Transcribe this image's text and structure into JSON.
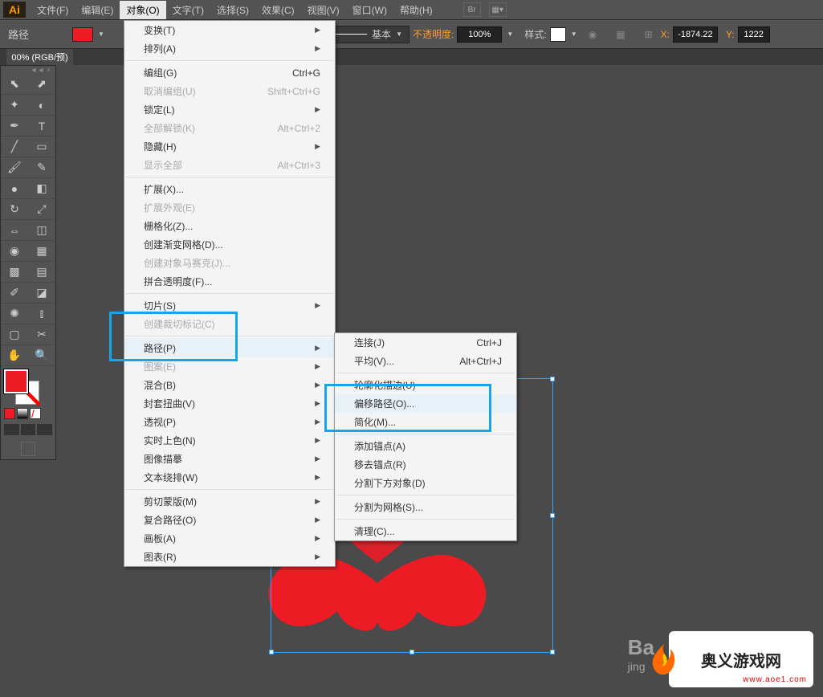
{
  "app": {
    "logo": "Ai"
  },
  "menu": {
    "items": [
      "文件(F)",
      "编辑(E)",
      "对象(O)",
      "文字(T)",
      "选择(S)",
      "效果(C)",
      "视图(V)",
      "窗口(W)",
      "帮助(H)"
    ],
    "active_index": 2,
    "br_label": "Br"
  },
  "controlbar": {
    "selection_label": "路径",
    "fill_color": "#ed1c24",
    "stroke_label": "基本",
    "opacity_label": "不透明度:",
    "opacity_value": "100%",
    "style_label": "样式:",
    "x_label": "X:",
    "x_value": "-1874.22",
    "y_label": "Y:",
    "y_value": "1222"
  },
  "doc": {
    "tab_label": "00% (RGB/预)"
  },
  "dropdown": {
    "groups": [
      [
        {
          "label": "变换(T)",
          "sub": true
        },
        {
          "label": "排列(A)",
          "sub": true
        }
      ],
      [
        {
          "label": "编组(G)",
          "shortcut": "Ctrl+G"
        },
        {
          "label": "取消编组(U)",
          "shortcut": "Shift+Ctrl+G",
          "disabled": true
        },
        {
          "label": "锁定(L)",
          "sub": true
        },
        {
          "label": "全部解锁(K)",
          "shortcut": "Alt+Ctrl+2",
          "disabled": true
        },
        {
          "label": "隐藏(H)",
          "sub": true
        },
        {
          "label": "显示全部",
          "shortcut": "Alt+Ctrl+3",
          "disabled": true
        }
      ],
      [
        {
          "label": "扩展(X)..."
        },
        {
          "label": "扩展外观(E)",
          "disabled": true
        },
        {
          "label": "栅格化(Z)..."
        },
        {
          "label": "创建渐变网格(D)..."
        },
        {
          "label": "创建对象马赛克(J)...",
          "disabled": true
        },
        {
          "label": "拼合透明度(F)..."
        }
      ],
      [
        {
          "label": "切片(S)",
          "sub": true
        },
        {
          "label": "创建裁切标记(C)",
          "disabled": true
        }
      ],
      [
        {
          "label": "路径(P)",
          "sub": true,
          "hover": true
        },
        {
          "label": "图案(E)",
          "sub": true,
          "disabled": true
        },
        {
          "label": "混合(B)",
          "sub": true
        },
        {
          "label": "封套扭曲(V)",
          "sub": true
        },
        {
          "label": "透视(P)",
          "sub": true
        },
        {
          "label": "实时上色(N)",
          "sub": true
        },
        {
          "label": "图像描摹",
          "sub": true
        },
        {
          "label": "文本绕排(W)",
          "sub": true
        }
      ],
      [
        {
          "label": "剪切蒙版(M)",
          "sub": true
        },
        {
          "label": "复合路径(O)",
          "sub": true
        },
        {
          "label": "画板(A)",
          "sub": true
        },
        {
          "label": "图表(R)",
          "sub": true
        }
      ]
    ]
  },
  "submenu": {
    "items": [
      {
        "label": "连接(J)",
        "shortcut": "Ctrl+J"
      },
      {
        "label": "平均(V)...",
        "shortcut": "Alt+Ctrl+J"
      },
      {
        "sep": true
      },
      {
        "label": "轮廓化描边(U)"
      },
      {
        "label": "偏移路径(O)...",
        "hover": true
      },
      {
        "label": "简化(M)..."
      },
      {
        "sep": true
      },
      {
        "label": "添加锚点(A)"
      },
      {
        "label": "移去锚点(R)"
      },
      {
        "label": "分割下方对象(D)"
      },
      {
        "sep": true
      },
      {
        "label": "分割为网格(S)..."
      },
      {
        "sep": true
      },
      {
        "label": "清理(C)..."
      }
    ]
  },
  "watermark": {
    "baidu": "Ba",
    "baidu_sub": "jing",
    "site_name": "奥义游戏网",
    "site_url": "www.aoe1.com"
  }
}
